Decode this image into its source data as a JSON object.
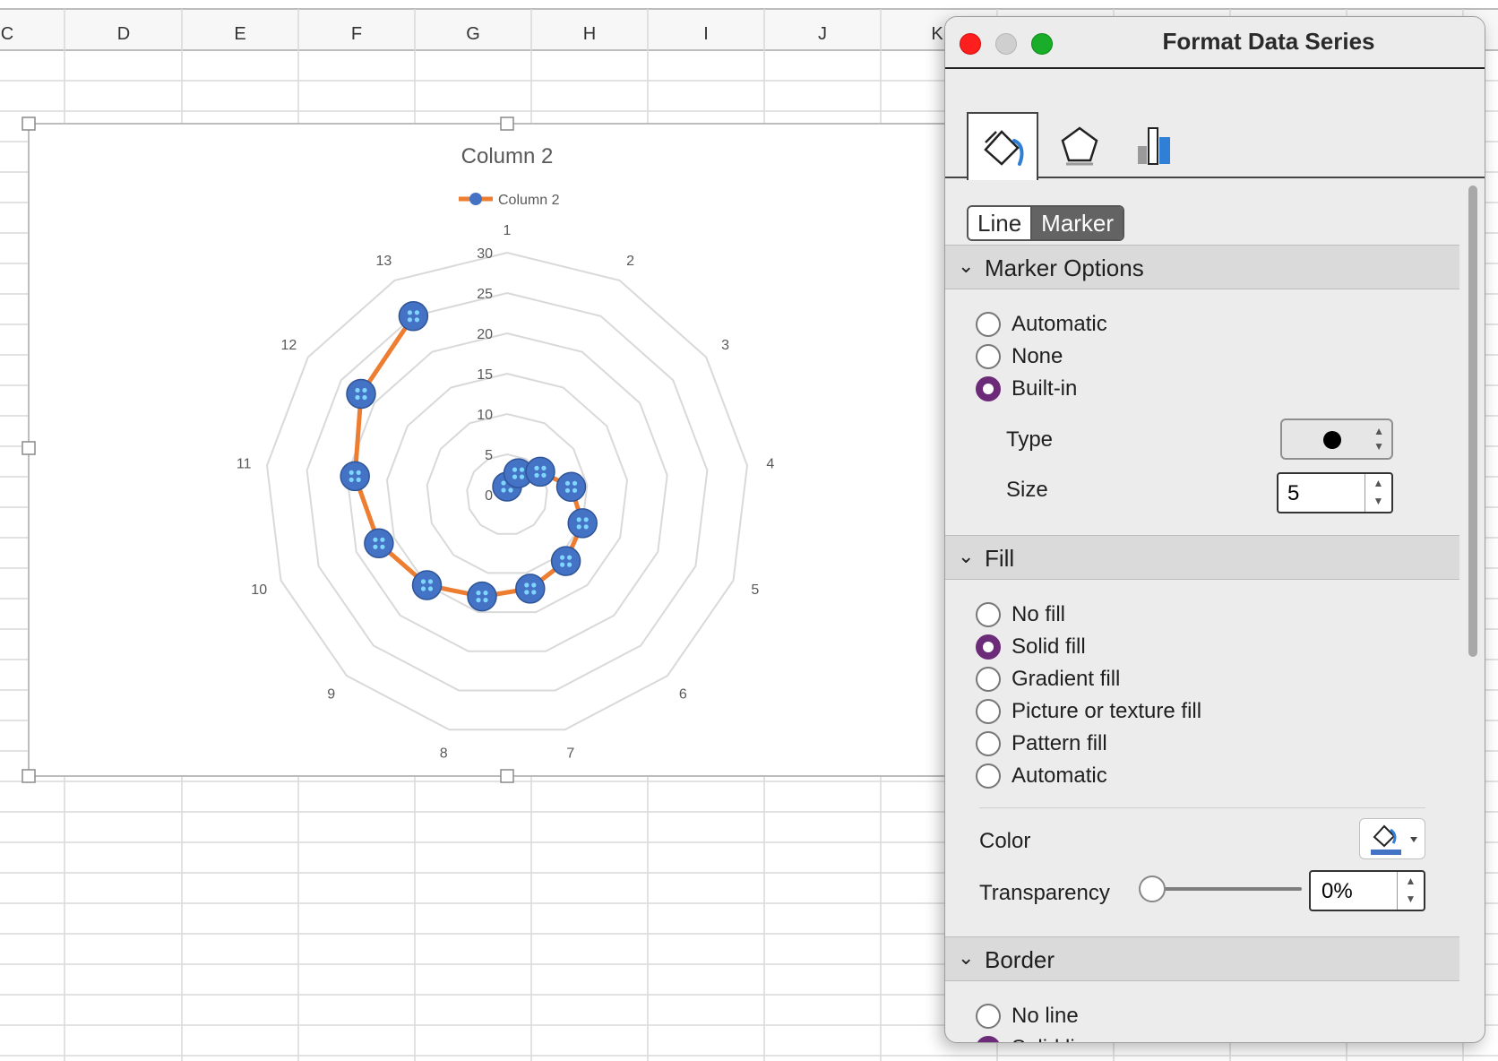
{
  "sheet": {
    "columns": [
      "C",
      "D",
      "E",
      "F",
      "G",
      "H",
      "I",
      "J",
      "K"
    ]
  },
  "chart": {
    "series_color": "#ED7D31",
    "marker_color": "#4472C4"
  },
  "chart_data": {
    "type": "radar",
    "title": "Column 2",
    "categories": [
      "1",
      "2",
      "3",
      "4",
      "5",
      "6",
      "7",
      "8",
      "9",
      "10",
      "11",
      "12",
      "13"
    ],
    "series": [
      {
        "name": "Column 2",
        "values": [
          1,
          3,
          5,
          8,
          10,
          11,
          12,
          13,
          15,
          17,
          19,
          22,
          25
        ]
      }
    ],
    "radial_ticks": [
      "0",
      "5",
      "10",
      "15",
      "20",
      "25",
      "30"
    ],
    "rlim": [
      0,
      30
    ],
    "legend": "top"
  },
  "panel": {
    "title": "Format Data Series",
    "tabs": [
      "fill-line",
      "effects",
      "series-options"
    ],
    "segment": {
      "line": "Line",
      "marker": "Marker",
      "selected": "Marker"
    },
    "marker_options": {
      "title": "Marker Options",
      "options": [
        "Automatic",
        "None",
        "Built-in"
      ],
      "selected": "Built-in",
      "type_label": "Type",
      "size_label": "Size",
      "size_value": "5"
    },
    "fill": {
      "title": "Fill",
      "options": [
        "No fill",
        "Solid fill",
        "Gradient fill",
        "Picture or texture fill",
        "Pattern fill",
        "Automatic"
      ],
      "selected": "Solid fill",
      "color_label": "Color",
      "color_value": "#4472C4",
      "transparency_label": "Transparency",
      "transparency_value": "0%",
      "transparency_fraction": 0
    },
    "border": {
      "title": "Border",
      "options": [
        "No line",
        "Solid line"
      ],
      "selected": "Solid line"
    },
    "accent": "#6c2b78"
  }
}
